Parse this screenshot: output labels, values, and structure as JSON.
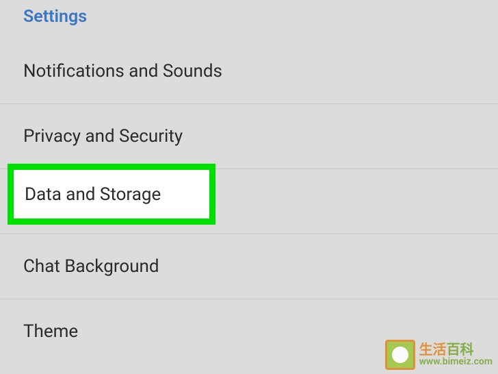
{
  "header": {
    "title": "Settings"
  },
  "settings": {
    "items": [
      {
        "label": "Notifications and Sounds"
      },
      {
        "label": "Privacy and Security"
      },
      {
        "label": "Data and Storage"
      },
      {
        "label": "Chat Background"
      },
      {
        "label": "Theme"
      }
    ]
  },
  "highlight": {
    "label": "Data and Storage"
  },
  "watermark": {
    "cn_part1": "生活",
    "cn_part2": "百科",
    "url": "www.bimeiz.com"
  }
}
